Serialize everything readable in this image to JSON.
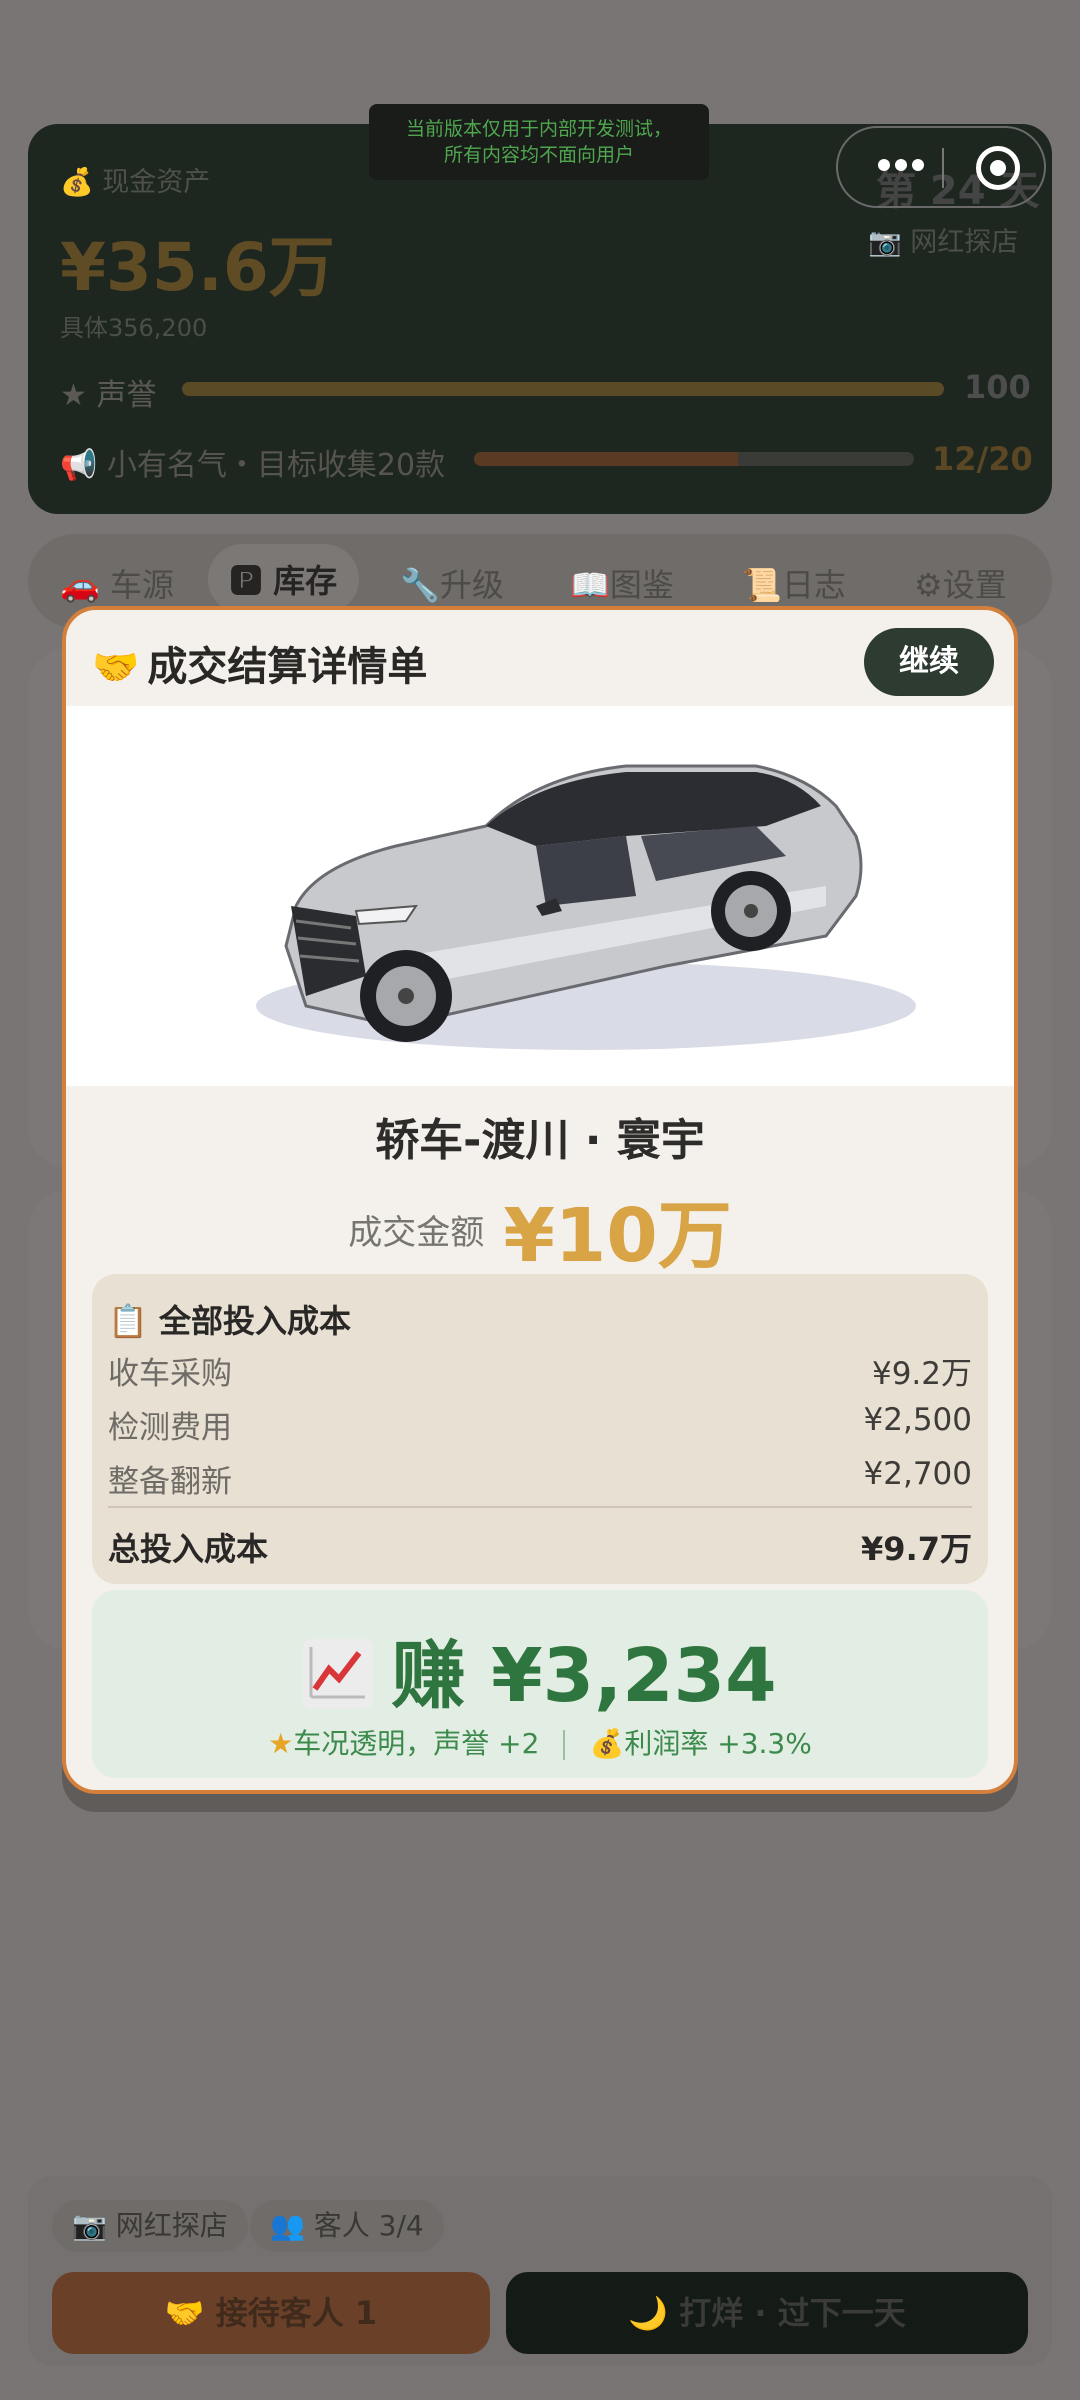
{
  "dev_banner": {
    "line1": "当前版本仅用于内部开发测试，",
    "line2": "所有内容均不面向用户"
  },
  "stats": {
    "cash_icon": "money-bag-icon",
    "cash_label": "现金资产",
    "cash_value": "¥35.6万",
    "cash_detail": "具体356,200",
    "day": "第 24 天",
    "shop": "网红探店",
    "reputation_label": "声誉",
    "reputation_value": "100",
    "goal_label": "小有名气・目标收集20款",
    "goal_progress": 0.6,
    "goal_value": "12/20"
  },
  "tabs": [
    {
      "label": "车源",
      "icon": "car-icon"
    },
    {
      "label": "库存",
      "icon": "parking-icon"
    },
    {
      "label": "升级",
      "icon": "wrench-icon"
    },
    {
      "label": "图鉴",
      "icon": "book-icon"
    },
    {
      "label": "日志",
      "icon": "scroll-icon"
    },
    {
      "label": "设置",
      "icon": "gear-icon"
    }
  ],
  "bottom": {
    "chip_shop": "网红探店",
    "chip_customers": "客人 3/4",
    "accept_button": "接待客人 1",
    "next_day_button": "打烊 · 过下一天"
  },
  "modal": {
    "title": "成交结算详情单",
    "title_icon": "handshake-icon",
    "continue_button": "继续",
    "car_name": "轿车-渡川 · 寰宇",
    "deal_label": "成交金额",
    "deal_value": "¥10万",
    "cost_title": "全部投入成本",
    "cost_items": [
      {
        "label": "收车采购",
        "value": "¥9.2万"
      },
      {
        "label": "检测费用",
        "value": "¥2,500"
      },
      {
        "label": "整备翻新",
        "value": "¥2,700"
      }
    ],
    "total_label": "总投入成本",
    "total_value": "¥9.7万",
    "profit_text": "赚 ¥3,234",
    "note_reputation": "车况透明，声誉 +2",
    "note_margin": "利润率 +3.3%"
  },
  "colors": {
    "accent_gold": "#d8a445",
    "profit_green": "#2f7540",
    "modal_border": "#d47f3c",
    "continue_button": "#2e3b31"
  }
}
